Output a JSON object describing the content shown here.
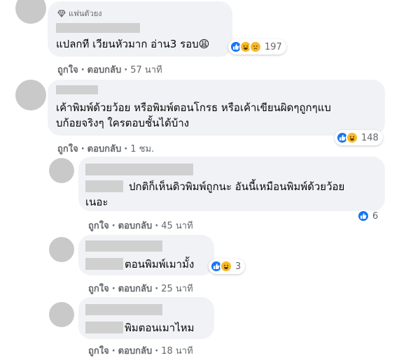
{
  "comments": [
    {
      "badge": "แฟนตัวยง",
      "lines": [
        "แปลกที เวียนหัวมาก อ่าน3 รอบ😩"
      ],
      "reactions": {
        "icons": [
          "like-icon",
          "laugh-icon",
          "sad-icon"
        ],
        "count": "197"
      },
      "like_label": "ถูกใจ",
      "reply_label": "ตอบกลับ",
      "time": "57 นาที"
    },
    {
      "lines": [
        "เค้าพิมพ์ด้วยว้อย หรือพิมพ์ตอนโกรธ หรือเค้าเขียนผิดๆถูกๆแบ",
        "บก้อยจริงๆ ใครตอบชั้นได้บ้าง"
      ],
      "reactions": {
        "icons": [
          "like-icon",
          "laugh-icon"
        ],
        "count": "148"
      },
      "like_label": "ถูกใจ",
      "reply_label": "ตอบกลับ",
      "time": "1 ชม."
    },
    {
      "lines": [
        "ปกติก็เห็นดิวพิมพ์ถูกนะ อันนี้เหมือนพิมพ์ด้วยว้อย",
        "เนอะ"
      ],
      "reactions": {
        "icons": [
          "like-icon"
        ],
        "count": "6"
      },
      "like_label": "ถูกใจ",
      "reply_label": "ตอบกลับ",
      "time": "45 นาที"
    },
    {
      "lines": [
        "ตอนพิมพ์เมามั้ง"
      ],
      "reactions": {
        "icons": [
          "like-icon",
          "laugh-icon"
        ],
        "count": "3"
      },
      "like_label": "ถูกใจ",
      "reply_label": "ตอบกลับ",
      "time": "25 นาที"
    },
    {
      "lines": [
        "พิมตอนเมาไหม"
      ],
      "like_label": "ถูกใจ",
      "reply_label": "ตอบกลับ",
      "time": "18 นาที"
    }
  ],
  "colors": {
    "bubble": "#f0f2f5",
    "like": "#1877f2",
    "emoji": "#f7b928",
    "meta": "#65676b"
  }
}
